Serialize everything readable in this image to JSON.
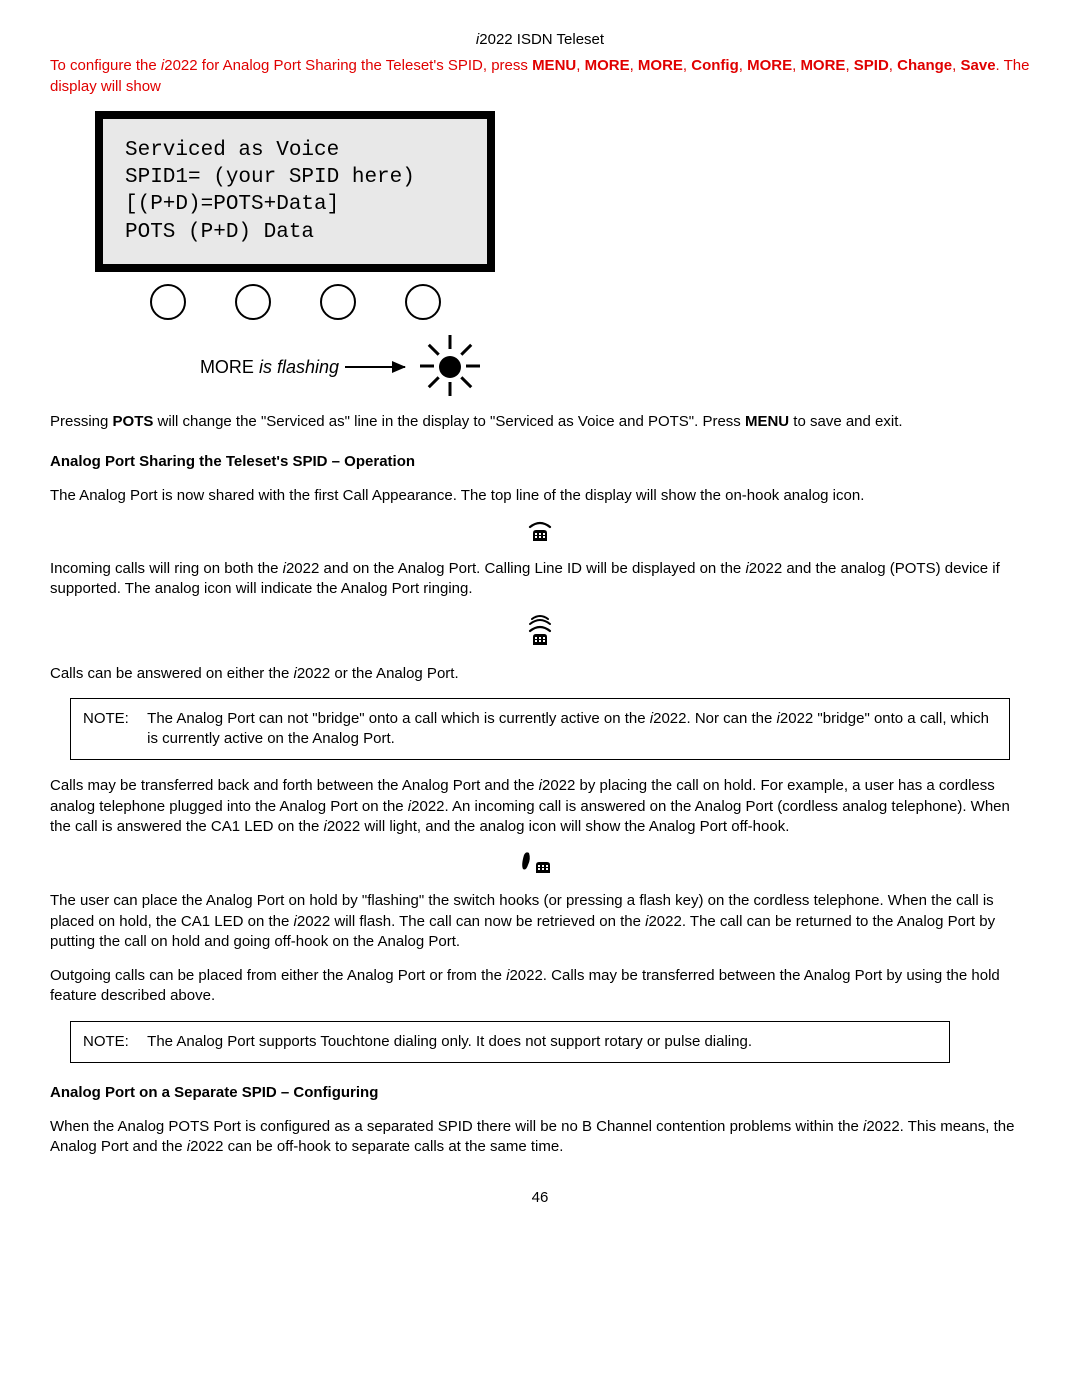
{
  "header": {
    "title_prefix": "i",
    "title_rest": "2022 ISDN Teleset"
  },
  "intro": {
    "pre": "To configure the ",
    "model_i": "i",
    "model_rest": "2022 for Analog Port Sharing the Teleset's SPID, press ",
    "seq": [
      "MENU",
      "MORE",
      "MORE",
      "Config",
      "MORE",
      "MORE",
      "SPID",
      "Change",
      "Save"
    ],
    "post": ". The display will show"
  },
  "lcd": {
    "line1": "Serviced as Voice",
    "line2": "SPID1= (your SPID here)",
    "line3": "[(P+D)=POTS+Data]",
    "line4": "POTS (P+D) Data"
  },
  "flash_label": {
    "more": "MORE ",
    "isflash": "is flashing"
  },
  "para_after_display": {
    "p1a": "Pressing ",
    "p1b": "POTS",
    "p1c": " will change the \"Serviced as\" line in the display to \"Serviced as Voice and POTS\". Press ",
    "p1d": "MENU",
    "p1e": " to save and exit."
  },
  "heading_op": "Analog Port Sharing the Teleset's SPID – Operation",
  "op_p1": "The Analog Port is now shared with the first Call Appearance. The top line of the display will show the on-hook analog icon.",
  "op_p2a": "Incoming calls will ring on both the ",
  "op_p2_i": "i",
  "op_p2b": "2022 and on the Analog Port. Calling Line ID will be displayed on the ",
  "op_p2c": "2022 and the analog (POTS) device if supported. The analog icon will indicate the Analog Port ringing.",
  "op_p3a": "Calls can be answered on either the ",
  "op_p3b": "2022 or the Analog Port.",
  "note1": {
    "label": "NOTE:",
    "text_a": "The Analog Port can not \"bridge\" onto a call which is currently active on the ",
    "text_b": "2022. Nor can the ",
    "text_c": "2022 \"bridge\" onto a call, which is currently active on the Analog Port."
  },
  "op_p4a": "Calls may be transferred back and forth between the Analog Port and the ",
  "op_p4b": "2022 by placing the call on hold. For example, a user has a cordless analog telephone plugged into the Analog Port on the ",
  "op_p4c": "2022. An incoming call is answered on the Analog Port (cordless analog telephone). When the call is answered the CA1 LED on the ",
  "op_p4d": "2022 will light, and the analog icon will show the Analog Port off-hook.",
  "op_p5a": "The user can place the Analog Port on hold by \"flashing\" the switch hooks (or pressing a flash key) on the cordless telephone. When the call is placed on hold, the CA1 LED on the ",
  "op_p5b": "2022 will flash. The call can now be retrieved on the ",
  "op_p5c": "2022. The call can be returned to the Analog Port by putting the call on hold and going off-hook on the Analog Port.",
  "op_p6a": "Outgoing calls can be placed from either the Analog Port or from the ",
  "op_p6b": "2022. Calls may be transferred between the Analog Port by using the hold feature described above.",
  "note2": {
    "label": "NOTE:",
    "text": "The Analog Port supports Touchtone dialing only. It does not support rotary or pulse dialing."
  },
  "heading_sep": "Analog Port on a Separate SPID – Configuring",
  "sep_p1a": "When the Analog POTS Port is configured as a separated SPID there will be no B Channel contention problems within the ",
  "sep_p1b": "2022. This means, the Analog Port and the ",
  "sep_p1c": "2022 can be off-hook to separate calls at the same time.",
  "page_number": "46"
}
